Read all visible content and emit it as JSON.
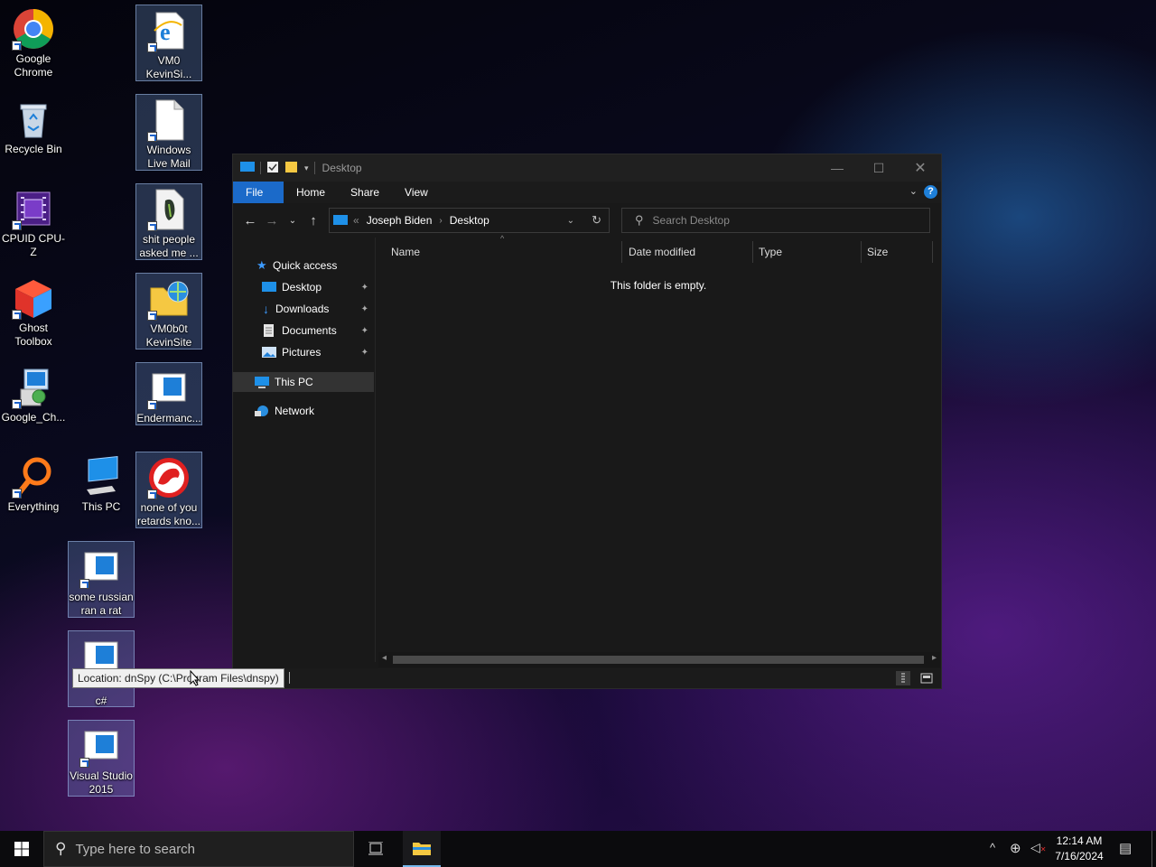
{
  "desktop": {
    "icons": [
      {
        "label": "Google Chrome",
        "icon": "chrome-icon"
      },
      {
        "label": "Recycle Bin",
        "icon": "recycle-bin-icon"
      },
      {
        "label": "CPUID CPU-Z",
        "icon": "cpuz-icon"
      },
      {
        "label": "Ghost Toolbox",
        "icon": "ghost-toolbox-icon"
      },
      {
        "label": "Google_Ch...",
        "icon": "installer-icon"
      },
      {
        "label": "Everything",
        "icon": "everything-icon"
      },
      {
        "label": "This PC",
        "icon": "this-pc-icon"
      },
      {
        "label": "VM0 KevinSi...",
        "icon": "internet-explorer-icon"
      },
      {
        "label": "Windows Live Mail",
        "icon": "document-icon"
      },
      {
        "label": "shit people asked me ...",
        "icon": "archive-icon"
      },
      {
        "label": "VM0b0t KevinSite",
        "icon": "network-folder-icon"
      },
      {
        "label": "Endermanc...",
        "icon": "app-window-icon"
      },
      {
        "label": "none of you retards kno...",
        "icon": "red-logo-icon"
      },
      {
        "label": "some russian ran a rat",
        "icon": "app-window-icon"
      },
      {
        "label": "c#",
        "icon": "app-window-icon"
      },
      {
        "label": "Visual Studio 2015",
        "icon": "app-window-icon"
      }
    ]
  },
  "explorer": {
    "title": "Desktop",
    "ribbon_tabs": [
      "File",
      "Home",
      "Share",
      "View"
    ],
    "breadcrumb": [
      "Joseph Biden",
      "Desktop"
    ],
    "breadcrumb_overflow": "«",
    "search_placeholder": "Search Desktop",
    "nav": {
      "quick_access": "Quick access",
      "pinned": [
        "Desktop",
        "Downloads",
        "Documents",
        "Pictures"
      ],
      "this_pc": "This PC",
      "network": "Network"
    },
    "columns": [
      "Name",
      "Date modified",
      "Type",
      "Size"
    ],
    "empty_message": "This folder is empty."
  },
  "tooltip": "Location: dnSpy (C:\\Program Files\\dnspy)",
  "taskbar": {
    "search_placeholder": "Type here to search",
    "time": "12:14 AM",
    "date": "7/16/2024"
  },
  "colors": {
    "accent": "#1b6ac9",
    "window_bg": "#191919",
    "taskbar_bg": "#0b0b0d"
  }
}
